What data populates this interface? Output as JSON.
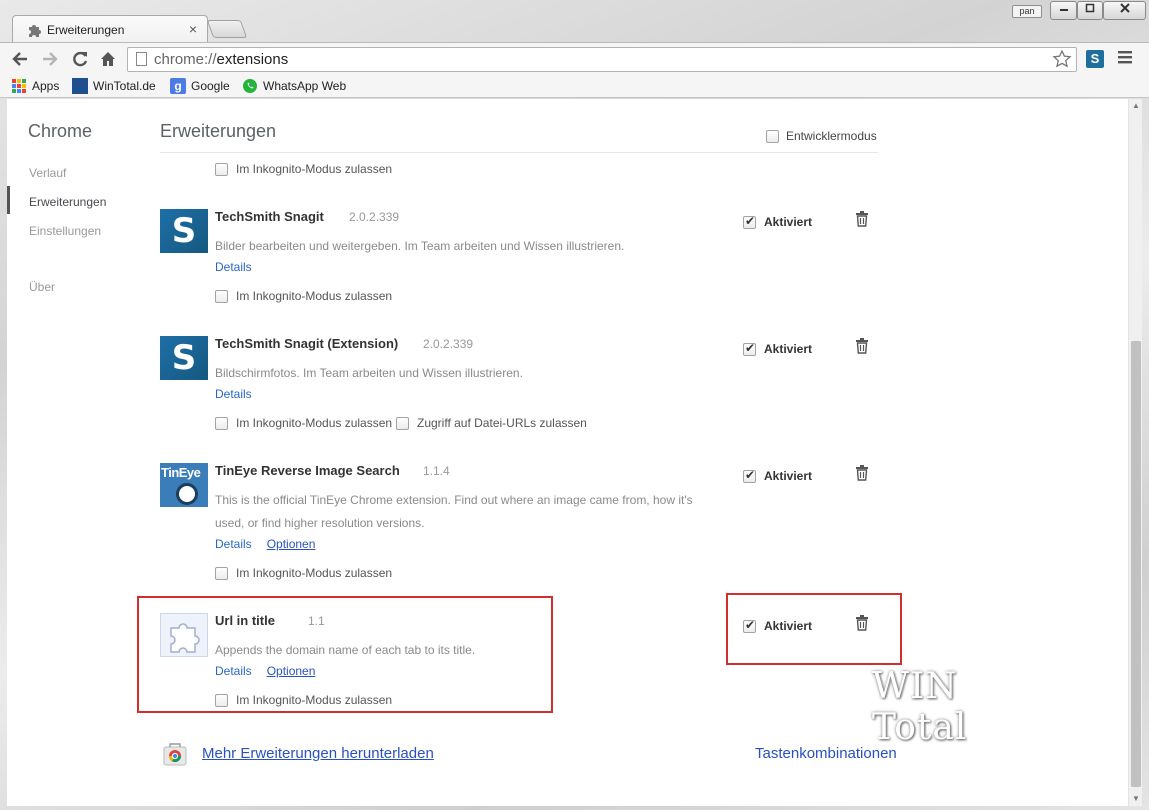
{
  "window": {
    "tab_title": "Erweiterungen",
    "tab_close": "×",
    "user_badge": "pan"
  },
  "toolbar": {
    "url_scheme": "chrome://",
    "url_path": "extensions",
    "snagit_badge": "S"
  },
  "bookmarks": [
    {
      "label": "Apps"
    },
    {
      "label": "WinTotal.de"
    },
    {
      "label": "Google"
    },
    {
      "label": "WhatsApp Web"
    }
  ],
  "sidebar": {
    "title": "Chrome",
    "items": [
      {
        "label": "Verlauf"
      },
      {
        "label": "Erweiterungen"
      },
      {
        "label": "Einstellungen"
      },
      {
        "label": "Über"
      }
    ]
  },
  "main": {
    "title": "Erweiterungen",
    "devmode_label": "Entwicklermodus",
    "incognito_label": "Im Inkognito-Modus zulassen",
    "file_urls_label": "Zugriff auf Datei-URLs zulassen",
    "enabled_label": "Aktiviert",
    "details_label": "Details",
    "options_label": "Optionen"
  },
  "extensions": [
    {
      "name": "TechSmith Snagit",
      "version": "2.0.2.339",
      "description": "Bilder bearbeiten und weitergeben. Im Team arbeiten und Wissen illustrieren.",
      "enabled": true
    },
    {
      "name": "TechSmith Snagit (Extension)",
      "version": "2.0.2.339",
      "description": "Bildschirmfotos. Im Team arbeiten und Wissen illustrieren.",
      "enabled": true
    },
    {
      "name": "TinEye Reverse Image Search",
      "version": "1.1.4",
      "description_line1": "This is the official TinEye Chrome extension. Find out where an image came from, how it's",
      "description_line2": "used, or find higher resolution versions.",
      "logo_text": "TinEye",
      "enabled": true
    },
    {
      "name": "Url in title",
      "version": "1.1",
      "description": "Appends the domain name of each tab to its title.",
      "enabled": true
    }
  ],
  "footer": {
    "more_extensions": "Mehr Erweiterungen herunterladen",
    "shortcuts": "Tastenkombinationen"
  },
  "watermark": "WIN Total",
  "colors": {
    "highlight": "#d52c2c",
    "link": "#2a52be",
    "snagit_blue": "#1e6fa8"
  }
}
